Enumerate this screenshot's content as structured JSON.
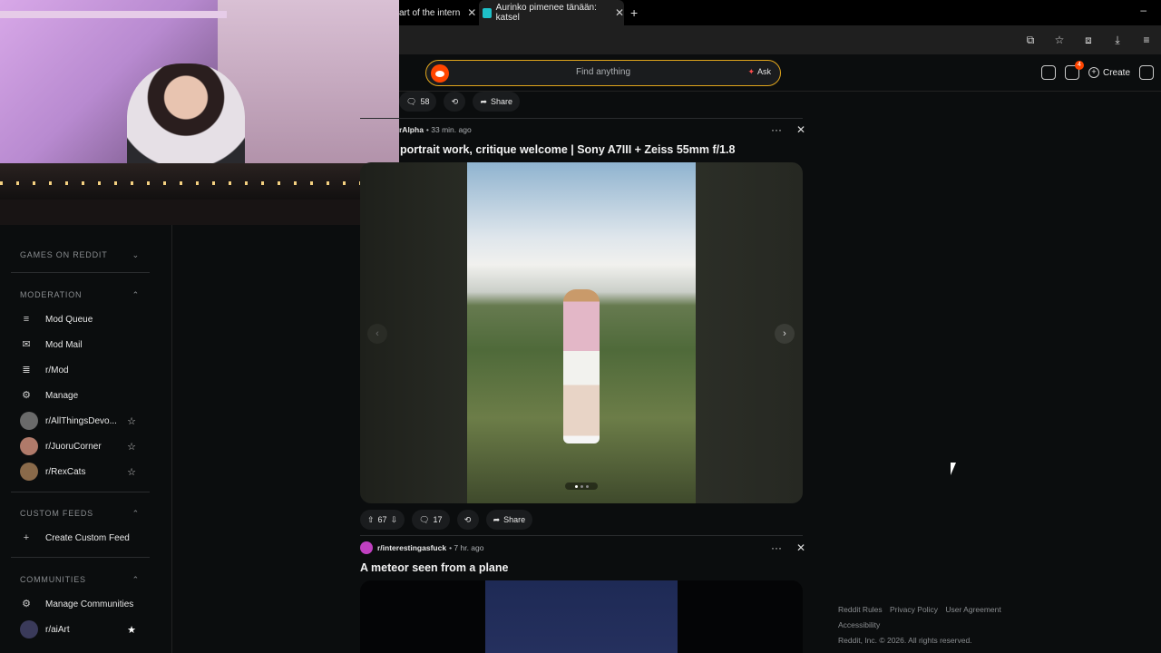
{
  "browser": {
    "tabs": [
      {
        "label": "art of the intern"
      },
      {
        "label": "Aurinko pimenee tänään: katsel"
      }
    ],
    "new_tab": "+",
    "minimize": "–"
  },
  "header": {
    "search_placeholder": "Find anything",
    "ask_label": "Ask",
    "chat_badge": "4",
    "create_label": "Create"
  },
  "sidebar": {
    "games_heading": "GAMES ON REDDIT",
    "moderation_heading": "MODERATION",
    "moderation_items": [
      "Mod Queue",
      "Mod Mail",
      "r/Mod",
      "Manage"
    ],
    "subreddits": [
      "r/AllThingsDevo...",
      "r/JuoruCorner",
      "r/RexCats"
    ],
    "custom_feeds_heading": "CUSTOM FEEDS",
    "create_custom_feed": "Create Custom Feed",
    "communities_heading": "COMMUNITIES",
    "manage_communities": "Manage Communities",
    "community_items": [
      "r/aiArt"
    ]
  },
  "feed": {
    "top_bar": {
      "comments": "58",
      "share": "Share"
    },
    "post1": {
      "subreddit": "rAlpha",
      "time": "• 33 min. ago",
      "title": "portrait work, critique welcome | Sony A7III + Zeiss 55mm f/1.8",
      "upvotes": "67",
      "comments": "17",
      "share": "Share",
      "carousel_position": 1,
      "carousel_count": 3
    },
    "post2": {
      "subreddit": "r/interestingasfuck",
      "time": "• 7 hr. ago",
      "title": "A meteor seen from a plane"
    }
  },
  "footer": {
    "links": [
      "Reddit Rules",
      "Privacy Policy",
      "User Agreement"
    ],
    "accessibility": "Accessibility",
    "copyright": "Reddit, Inc. © 2026. All rights reserved."
  }
}
